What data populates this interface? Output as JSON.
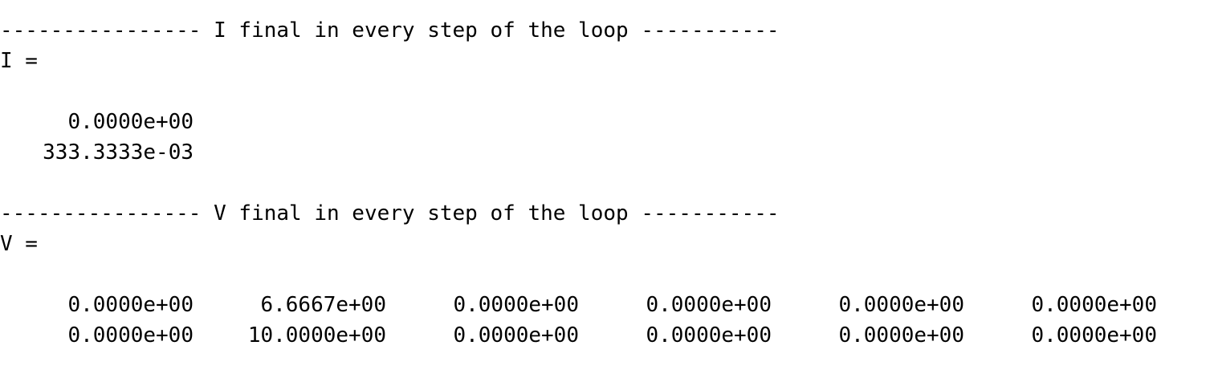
{
  "output": {
    "i_header": {
      "dashes_left": "----------------",
      "title": "I final in every step of the loop",
      "dashes_right": "-----------"
    },
    "i_assign": "I =",
    "i_values": [
      "0.0000e+00",
      "333.3333e-03"
    ],
    "v_header": {
      "dashes_left": "----------------",
      "title": "V final in every step of the loop",
      "dashes_right": "-----------"
    },
    "v_assign": "V =",
    "v_rows": [
      [
        "0.0000e+00",
        "6.6667e+00",
        "0.0000e+00",
        "0.0000e+00",
        "0.0000e+00",
        "0.0000e+00"
      ],
      [
        "0.0000e+00",
        "10.0000e+00",
        "0.0000e+00",
        "0.0000e+00",
        "0.0000e+00",
        "0.0000e+00"
      ]
    ]
  }
}
